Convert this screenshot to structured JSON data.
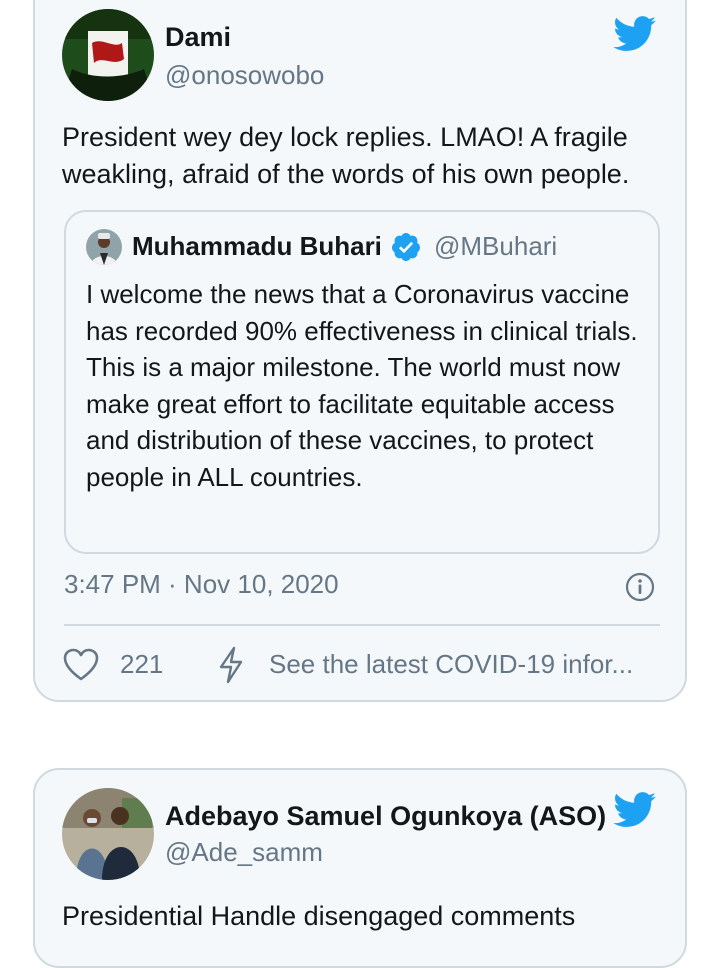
{
  "colors": {
    "twitter_blue": "#1da1f2",
    "secondary_text": "#657786",
    "border": "#cfd9de"
  },
  "tweet1": {
    "author_name": "Dami",
    "author_handle": "@onosowobo",
    "text": "President wey dey lock replies. LMAO! A fragile weakling, afraid of the words of his own people.",
    "quoted": {
      "author_name": "Muhammadu Buhari",
      "author_handle": "@MBuhari",
      "verified_icon": "verified-badge-icon",
      "text": "I welcome the news that a Coronavirus vaccine has recorded 90% effectiveness in clinical trials. This is a major milestone. The world must now make great effort to facilitate equitable access and distribution of these vaccines, to protect people in ALL countries."
    },
    "timestamp": "3:47 PM · Nov 10, 2020",
    "like_count": "221",
    "covid_link": "See the latest COVID-19 infor..."
  },
  "tweet2": {
    "author_name": "Adebayo Samuel Ogunkoya (ASO)",
    "author_handle": "@Ade_samm",
    "text": "Presidential Handle disengaged comments"
  }
}
